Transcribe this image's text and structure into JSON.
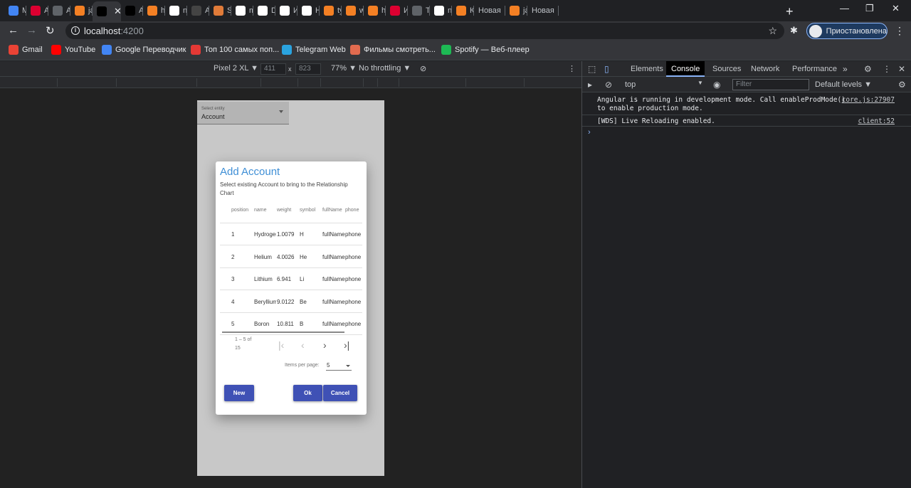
{
  "browser": {
    "tabs": [
      {
        "label": "Me",
        "icon": "chat-icon",
        "color": "#4285f4"
      },
      {
        "label": "An",
        "icon": "angular-icon",
        "color": "#dd0031"
      },
      {
        "label": "An",
        "icon": "document-icon",
        "color": "#5f6368"
      },
      {
        "label": "jav",
        "icon": "stackoverflow-icon",
        "color": "#f48024"
      },
      {
        "label": "",
        "icon": "angular-a-icon",
        "color": "#000000",
        "active": true
      },
      {
        "label": "Ad",
        "icon": "medium-icon",
        "color": "#000000"
      },
      {
        "label": "htt",
        "icon": "stackoverflow-icon",
        "color": "#f48024"
      },
      {
        "label": "ne",
        "icon": "google-icon",
        "color": "#ffffff"
      },
      {
        "label": "An",
        "icon": "circle-x-icon",
        "color": "#444444"
      },
      {
        "label": "Sc",
        "icon": "cookie-icon",
        "color": "#e07b39"
      },
      {
        "label": "me",
        "icon": "github-icon",
        "color": "#ffffff"
      },
      {
        "label": "De",
        "icon": "notion-icon",
        "color": "#ffffff"
      },
      {
        "label": "Ин",
        "icon": "notion-icon",
        "color": "#ffffff"
      },
      {
        "label": "Нс",
        "icon": "notion-icon",
        "color": "#ffffff"
      },
      {
        "label": "typ",
        "icon": "stackoverflow-icon",
        "color": "#f48024"
      },
      {
        "label": "wi",
        "icon": "stackoverflow-icon",
        "color": "#f48024"
      },
      {
        "label": "htt",
        "icon": "stackoverflow-icon",
        "color": "#f48024"
      },
      {
        "label": "Ин",
        "icon": "angular-icon",
        "color": "#dd0031"
      },
      {
        "label": "Тур",
        "icon": "document-icon",
        "color": "#5f6368"
      },
      {
        "label": "ne",
        "icon": "google-icon",
        "color": "#ffffff"
      },
      {
        "label": "Ка",
        "icon": "stackoverflow-icon",
        "color": "#f48024"
      },
      {
        "label": "Новая",
        "icon": "",
        "color": ""
      },
      {
        "label": "jav",
        "icon": "stackoverflow-icon",
        "color": "#f48024"
      },
      {
        "label": "Новая",
        "icon": "",
        "color": ""
      }
    ],
    "url_host": "localhost",
    "url_port": ":4200",
    "profile_label": "Приостановлена",
    "bookmarks": [
      {
        "label": "Gmail",
        "icon": "gmail-icon",
        "color": "#ea4335"
      },
      {
        "label": "YouTube",
        "icon": "youtube-icon",
        "color": "#ff0000"
      },
      {
        "label": "Google Переводчик",
        "icon": "translate-icon",
        "color": "#4285f4"
      },
      {
        "label": "Топ 100 самых поп...",
        "icon": "top100-icon",
        "color": "#e53935"
      },
      {
        "label": "Telegram Web",
        "icon": "telegram-icon",
        "color": "#2aa3df"
      },
      {
        "label": "Фильмы смотреть...",
        "icon": "film-icon",
        "color": "#e26b4f"
      },
      {
        "label": "Spotify — Веб-плеер",
        "icon": "spotify-icon",
        "color": "#1db954"
      }
    ]
  },
  "device_toolbar": {
    "device": "Pixel 2 XL ▼",
    "width": "411",
    "times": "x",
    "height": "823",
    "zoom": "77% ▼",
    "throttling": "No throttling ▼"
  },
  "app": {
    "select_label": "Select entity",
    "select_value": "Account",
    "dialog": {
      "title": "Add Account",
      "subtitle": "Select existing Account to bring to the Relationship Chart",
      "columns": [
        "position",
        "name",
        "weight",
        "symbol",
        "fullName",
        "phone"
      ],
      "rows": [
        [
          "1",
          "Hydrogen",
          "1.0079",
          "H",
          "fullName",
          "phone"
        ],
        [
          "2",
          "Helium",
          "4.0026",
          "He",
          "fullName",
          "phone"
        ],
        [
          "3",
          "Lithium",
          "6.941",
          "Li",
          "fullName",
          "phone"
        ],
        [
          "4",
          "Beryllium",
          "9.0122",
          "Be",
          "fullName",
          "phone"
        ],
        [
          "5",
          "Boron",
          "10.811",
          "B",
          "fullName",
          "phone"
        ]
      ],
      "range_label": "1 – 5 of 15",
      "items_per_page_label": "Items per page:",
      "items_per_page_value": "5",
      "new_label": "New",
      "ok_label": "Ok",
      "cancel_label": "Cancel",
      "button_color": "#3f51b5",
      "title_color": "#3f8fd6"
    }
  },
  "devtools": {
    "tabs": [
      "Elements",
      "Console",
      "Sources",
      "Network",
      "Performance"
    ],
    "active_tab": "Console",
    "context": "top",
    "filter_placeholder": "Filter",
    "levels": "Default levels ▼",
    "messages": [
      {
        "text": "Angular is running in development mode. Call enableProdMode() to enable production mode.",
        "source": "core.js:27907"
      },
      {
        "text": "[WDS] Live Reloading enabled.",
        "source": "client:52"
      }
    ],
    "prompt": "›"
  }
}
